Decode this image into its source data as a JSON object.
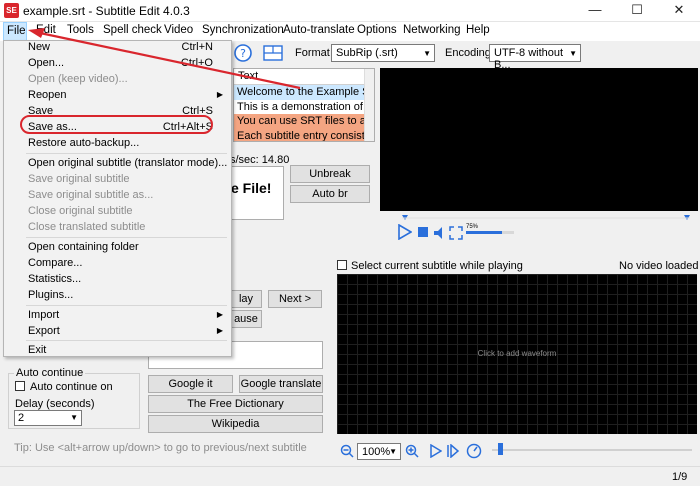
{
  "window": {
    "title": "example.srt - Subtitle Edit 4.0.3",
    "app_icon_text": "SE",
    "minimize": "—",
    "maximize": "☐",
    "close": "✕"
  },
  "menubar": [
    "File",
    "Edit",
    "Tools",
    "Spell check",
    "Video",
    "Synchronization",
    "Auto-translate",
    "Options",
    "Networking",
    "Help"
  ],
  "toolbar": {
    "format_label": "Format",
    "format_value": "SubRip (.srt)",
    "encoding_label": "Encoding",
    "encoding_value": "UTF-8 without B..."
  },
  "subtitle_list": {
    "header": "Text",
    "rows": [
      "Welcome to the Example S...",
      "This is a demonstration of ...",
      "You can use SRT files to a...",
      "Each subtitle entry consists..."
    ]
  },
  "editor": {
    "chars_per_sec": "s/sec: 14.80",
    "preview_text": "e File!",
    "unbreak": "Unbreak",
    "auto_br": "Auto br"
  },
  "video": {
    "volume": "75%"
  },
  "waveform": {
    "select_current": "Select current subtitle while playing",
    "no_video": "No video loaded",
    "click_to_add": "Click to add waveform",
    "zoom": "100%"
  },
  "translate_panel": {
    "play": "lay",
    "next": "Next >",
    "pause": "ause",
    "auto_continue_legend": "Auto continue",
    "auto_continue": "Auto continue on",
    "delay_label": "Delay (seconds)",
    "delay_value": "2",
    "google_it": "Google it",
    "google_translate": "Google translate",
    "free_dictionary": "The Free Dictionary",
    "wikipedia": "Wikipedia",
    "tip": "Tip: Use <alt+arrow up/down> to go to previous/next subtitle"
  },
  "status": {
    "position": "1/9"
  },
  "file_menu": {
    "items": [
      {
        "label": "New",
        "shortcut": "Ctrl+N",
        "disabled": false
      },
      {
        "label": "Open...",
        "shortcut": "Ctrl+O",
        "disabled": false
      },
      {
        "label": "Open (keep video)...",
        "shortcut": "",
        "disabled": true
      },
      {
        "label": "Reopen",
        "shortcut": "",
        "disabled": false
      },
      {
        "label": "Save",
        "shortcut": "Ctrl+S",
        "disabled": false
      },
      {
        "label": "Save as...",
        "shortcut": "Ctrl+Alt+S",
        "disabled": false
      },
      {
        "label": "Restore auto-backup...",
        "shortcut": "",
        "disabled": false
      },
      {
        "label": "Open original subtitle (translator mode)...",
        "shortcut": "",
        "disabled": false
      },
      {
        "label": "Save original subtitle",
        "shortcut": "",
        "disabled": true
      },
      {
        "label": "Save original subtitle as...",
        "shortcut": "",
        "disabled": true
      },
      {
        "label": "Close original subtitle",
        "shortcut": "",
        "disabled": true
      },
      {
        "label": "Close translated subtitle",
        "shortcut": "",
        "disabled": true
      },
      {
        "label": "Open containing folder",
        "shortcut": "",
        "disabled": false
      },
      {
        "label": "Compare...",
        "shortcut": "",
        "disabled": false
      },
      {
        "label": "Statistics...",
        "shortcut": "",
        "disabled": false
      },
      {
        "label": "Plugins...",
        "shortcut": "",
        "disabled": false
      },
      {
        "label": "Import",
        "shortcut": "",
        "disabled": false
      },
      {
        "label": "Export",
        "shortcut": "",
        "disabled": false
      },
      {
        "label": "Exit",
        "shortcut": "",
        "disabled": false
      }
    ]
  },
  "colors": {
    "highlight_annotation": "#d9262d",
    "selected_row": "#cce8ff",
    "salmon_row": "#f4a582",
    "accent_blue": "#2a6fdb"
  }
}
